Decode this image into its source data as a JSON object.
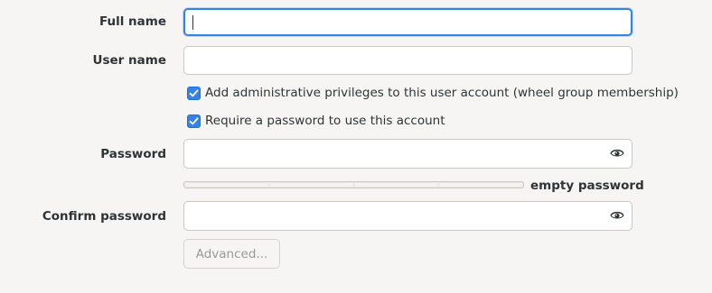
{
  "form": {
    "full_name": {
      "label": "Full name",
      "value": ""
    },
    "user_name": {
      "label": "User name",
      "value": ""
    },
    "admin_checkbox": {
      "label": "Add administrative privileges to this user account (wheel group membership)",
      "checked": true
    },
    "require_password_checkbox": {
      "label": "Require a password to use this account",
      "checked": true
    },
    "password": {
      "label": "Password",
      "value": "",
      "icon": "eye-icon"
    },
    "strength": {
      "label": "empty password",
      "level": 0
    },
    "confirm_password": {
      "label": "Confirm password",
      "value": "",
      "icon": "eye-icon"
    },
    "advanced_button": {
      "label": "Advanced..."
    }
  },
  "colors": {
    "accent": "#3584e4",
    "background": "#f6f5f4",
    "field_border": "#cdc7c2",
    "disabled_text": "#9a9996"
  }
}
